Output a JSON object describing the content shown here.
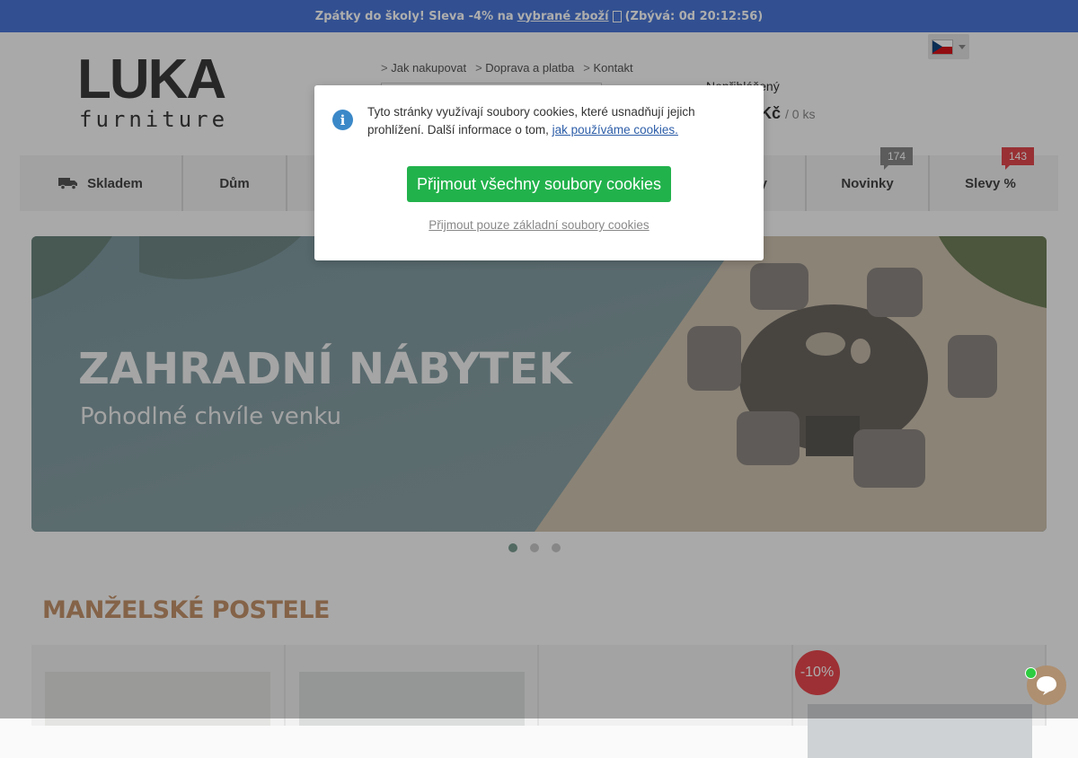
{
  "promo": {
    "text_before": "Zpátky do školy! Sleva -4% na",
    "link": "vybrané zboží",
    "text_after": "(Zbývá: 0d 20:12:56)"
  },
  "logo": {
    "line1": "LUKA",
    "line2": "furniture"
  },
  "toplinks": [
    "Jak nakupovat",
    "Doprava a platba",
    "Kontakt"
  ],
  "user": {
    "label": "Nepřihlášený"
  },
  "cart": {
    "price": "Kč",
    "count": "/ 0 ks"
  },
  "nav": {
    "items": [
      {
        "label": "Skladem",
        "icon": "truck-icon"
      },
      {
        "label": "Dům"
      },
      {
        "label": "y"
      },
      {
        "label": "Novinky",
        "badge": "174"
      },
      {
        "label": "Slevy %",
        "badge": "143"
      }
    ]
  },
  "hero": {
    "title": "ZAHRADNÍ NÁBYTEK",
    "subtitle": "Pohodlné chvíle venku"
  },
  "section": {
    "title": "MANŽELSKÉ POSTELE"
  },
  "products": {
    "discount": "-10%"
  },
  "cookie": {
    "text": "Tyto stránky využívají soubory cookies, které usnadňují jejich prohlížení. Další informace o tom,",
    "link": "jak používáme cookies.",
    "accept_all": "Přijmout všechny soubory cookies",
    "accept_basic": "Přijmout pouze základní soubory cookies"
  },
  "colors": {
    "promo_bg": "#4a77d6",
    "accent_green": "#22b24c",
    "section_title": "#c3926a",
    "badge_red": "#e0474d"
  }
}
